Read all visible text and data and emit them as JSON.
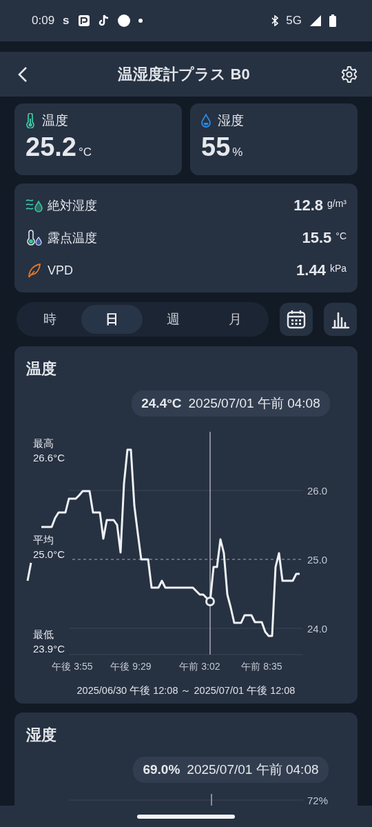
{
  "status_bar": {
    "time": "0:09",
    "notification_letter": "s",
    "network": "5G"
  },
  "header": {
    "title": "温湿度計プラス B0"
  },
  "current": [
    {
      "kind": "temperature",
      "label": "温度",
      "value": "25.2",
      "unit": "°C"
    },
    {
      "kind": "humidity",
      "label": "湿度",
      "value": "55",
      "unit": "%"
    }
  ],
  "metrics": [
    {
      "kind": "absolute",
      "label": "絶対湿度",
      "value": "12.8",
      "unit": "g/m³"
    },
    {
      "kind": "dewpoint",
      "label": "露点温度",
      "value": "15.5",
      "unit": "°C"
    },
    {
      "kind": "vpd",
      "label": "VPD",
      "value": "1.44",
      "unit": "kPa"
    }
  ],
  "periods": [
    {
      "label": "時",
      "selected": false
    },
    {
      "label": "日",
      "selected": true
    },
    {
      "label": "週",
      "selected": false
    },
    {
      "label": "月",
      "selected": false
    }
  ],
  "charts": [
    {
      "title": "温度",
      "tooltip": {
        "value": "24.4°C",
        "time": "2025/07/01 午前 04:08"
      },
      "stats": [
        {
          "label": "最高",
          "value": "26.6°C"
        },
        {
          "label": "平均",
          "value": "25.0°C"
        },
        {
          "label": "最低",
          "value": "23.9°C"
        }
      ],
      "range": "2025/06/30 午後 12:08 ～ 2025/07/01 午後 12:08",
      "chart_data": {
        "type": "line",
        "categories": [
          null,
          null,
          null,
          null,
          null,
          null,
          null,
          null,
          null,
          null,
          null,
          null,
          null,
          "午後 3:55",
          null,
          null,
          null,
          null,
          null,
          null,
          null,
          null,
          null,
          null,
          null,
          null,
          null,
          null,
          null,
          null,
          "午後 9:29",
          null,
          null,
          null,
          null,
          null,
          null,
          null,
          null,
          null,
          null,
          null,
          null,
          null,
          null,
          null,
          null,
          null,
          null,
          null,
          "午前 3:02",
          null,
          null,
          null,
          null,
          null,
          null,
          null,
          null,
          null,
          null,
          null,
          null,
          null,
          null,
          null,
          null,
          null,
          "午前 8:35",
          null,
          null,
          null,
          null,
          null,
          null,
          null,
          null,
          null,
          null,
          null
        ],
        "series": [
          {
            "color": "#eef0f3",
            "values": [
              24.69,
              24.95,
              null,
              null,
              25.47,
              25.47,
              25.47,
              25.47,
              25.6,
              25.68,
              25.68,
              25.68,
              25.88,
              25.88,
              25.88,
              25.93,
              25.99,
              25.99,
              25.99,
              25.68,
              25.68,
              25.68,
              25.3,
              25.57,
              25.57,
              25.57,
              25.5,
              25.1,
              26.1,
              26.59,
              26.59,
              25.78,
              25.38,
              25.0,
              25.0,
              25.0,
              24.59,
              24.59,
              24.59,
              24.69,
              24.59,
              24.59,
              24.59,
              24.59,
              24.59,
              24.59,
              24.59,
              24.59,
              24.59,
              24.54,
              24.49,
              24.49,
              24.44,
              24.39,
              24.89,
              24.89,
              25.29,
              25.09,
              24.49,
              24.3,
              24.08,
              24.08,
              24.08,
              24.19,
              24.19,
              24.19,
              24.09,
              24.09,
              24.09,
              23.95,
              23.89,
              23.89,
              24.89,
              25.09,
              24.69,
              24.69,
              24.69,
              24.69,
              24.79,
              24.79
            ]
          }
        ],
        "ylim": [
          23.6,
          26.85
        ],
        "yticks": [
          {
            "value": 24,
            "label": "24.0"
          },
          {
            "value": 25,
            "label": "25.0"
          },
          {
            "value": 26,
            "label": "26.0"
          }
        ],
        "ref_lines": [
          {
            "axis": "y",
            "value": 25.0
          }
        ]
      }
    },
    {
      "title": "湿度",
      "tooltip": {
        "value": "69.0%",
        "time": "2025/07/01 午前 04:08"
      },
      "y_tick": "72%"
    }
  ]
}
